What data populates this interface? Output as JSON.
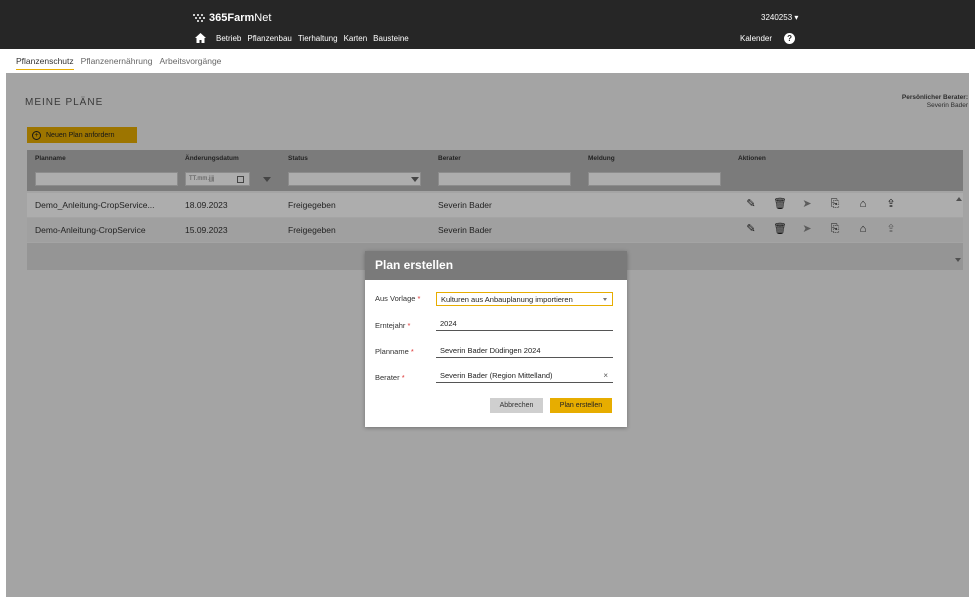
{
  "header": {
    "brand_bold": "365",
    "brand_farm": "Farm",
    "brand_net": "Net",
    "user_id": "3240253 ▾",
    "nav": [
      "Betrieb",
      "Pflanzenbau",
      "Tierhaltung",
      "Karten",
      "Bausteine"
    ],
    "calendar_label": "Kalender",
    "help_glyph": "?"
  },
  "tabs": [
    "Pflanzenschutz",
    "Pflanzenernährung",
    "Arbeitsvorgänge"
  ],
  "page": {
    "title": "MEINE PLÄNE",
    "advisor_label": "Persönlicher Berater:",
    "advisor_name": "Severin Bader",
    "request_button": "Neuen Plan anfordern"
  },
  "table": {
    "columns": [
      "Planname",
      "Änderungsdatum",
      "Status",
      "Berater",
      "Meldung",
      "Aktionen"
    ],
    "date_placeholder": "TT.mm.jjjj",
    "rows": [
      {
        "name": "Demo_Anleitung-CropService...",
        "date": "18.09.2023",
        "status": "Freigegeben",
        "advisor": "Severin Bader",
        "message": ""
      },
      {
        "name": "Demo-Anleitung-CropService",
        "date": "15.09.2023",
        "status": "Freigegeben",
        "advisor": "Severin Bader",
        "message": ""
      }
    ]
  },
  "modal": {
    "title": "Plan erstellen",
    "fields": [
      {
        "label": "Aus Vorlage",
        "value": "Kulturen aus Anbauplanung importieren"
      },
      {
        "label": "Erntejahr",
        "value": "2024"
      },
      {
        "label": "Planname",
        "value": "Severin Bader Düdingen 2024"
      },
      {
        "label": "Berater",
        "value": "Severin Bader (Region Mittelland)"
      }
    ],
    "required_mark": "*",
    "clear_glyph": "×",
    "cancel_label": "Abbrechen",
    "submit_label": "Plan erstellen"
  },
  "colors": {
    "accent": "#e7ad00",
    "topbar": "#262626",
    "modal_header": "#7a7a7a"
  }
}
